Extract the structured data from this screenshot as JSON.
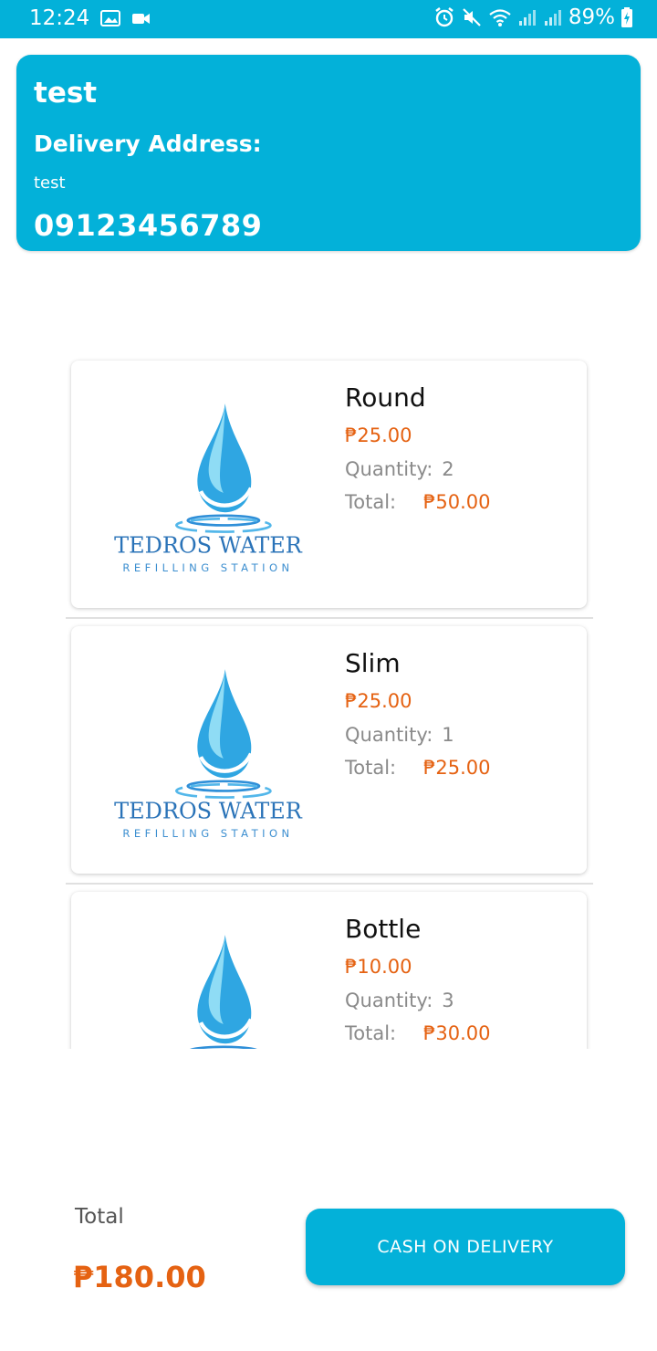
{
  "status_bar": {
    "time": "12:24",
    "battery": "89%"
  },
  "colors": {
    "accent": "#03b1d9",
    "price": "#e56212"
  },
  "customer": {
    "name": "test",
    "address_label": "Delivery Address:",
    "address": "test",
    "phone": "09123456789"
  },
  "logo": {
    "line1": "TEDROS WATER",
    "line2": "REFILLING STATION"
  },
  "items": [
    {
      "name": "Round",
      "price": "₱25.00",
      "quantity_label": "Quantity:",
      "quantity": "2",
      "total_label": "Total:",
      "total": "₱50.00"
    },
    {
      "name": "Slim",
      "price": "₱25.00",
      "quantity_label": "Quantity:",
      "quantity": "1",
      "total_label": "Total:",
      "total": "₱25.00"
    },
    {
      "name": "Bottle",
      "price": "₱10.00",
      "quantity_label": "Quantity:",
      "quantity": "3",
      "total_label": "Total:",
      "total": "₱30.00"
    }
  ],
  "footer": {
    "total_label": "Total",
    "total_value": "₱180.00",
    "button_label": "CASH ON DELIVERY"
  },
  "icons": [
    "image-icon",
    "video-icon",
    "alarm-icon",
    "mute-icon",
    "wifi-icon",
    "signal-icon",
    "battery-icon",
    "water-drop-icon"
  ]
}
